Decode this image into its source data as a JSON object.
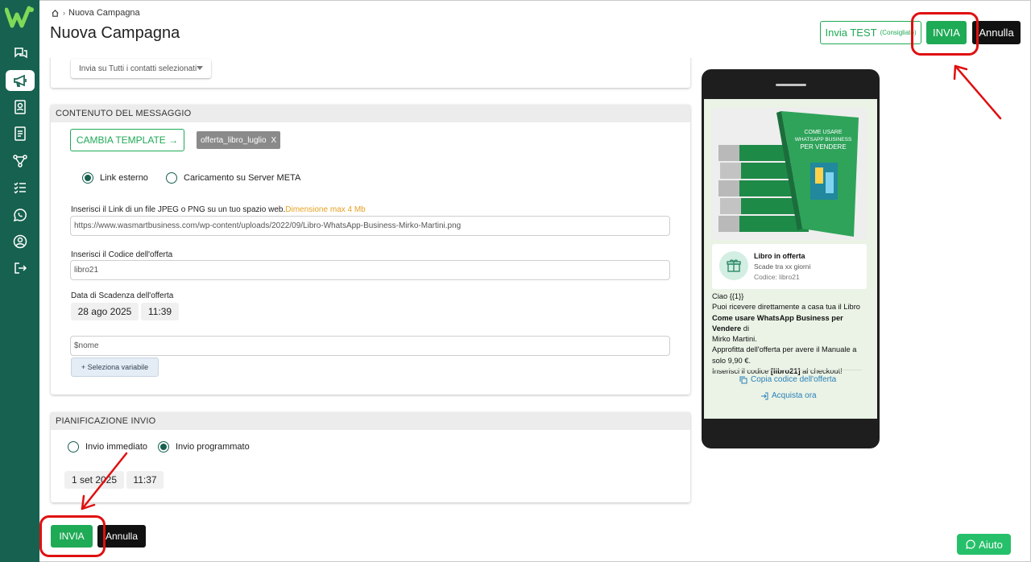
{
  "sidebar": {
    "items": [
      {
        "icon": "chat-icon"
      },
      {
        "icon": "megaphone-icon",
        "active": true
      },
      {
        "icon": "contacts-icon"
      },
      {
        "icon": "document-icon"
      },
      {
        "icon": "flow-icon"
      },
      {
        "icon": "checklist-icon"
      },
      {
        "icon": "whatsapp-icon"
      },
      {
        "icon": "user-icon"
      },
      {
        "icon": "logout-icon"
      }
    ]
  },
  "header": {
    "breadcrumb": "Nuova Campagna",
    "title": "Nuova Campagna",
    "btn_test": "Invia TEST",
    "btn_test_note": "(Consigliato)",
    "btn_invia": "INVIA",
    "btn_annulla": "Annulla"
  },
  "destinatari": {
    "select_value": "Invia su Tutti i contatti selezionati"
  },
  "contenuto": {
    "header": "CONTENUTO DEL MESSAGGIO",
    "btn_template": "CAMBIA TEMPLATE →",
    "template_chip": "offerta_libro_luglio",
    "chip_close": "X",
    "radio_link": "Link esterno",
    "radio_upload": "Caricamento su Server META",
    "link_label": "Inserisci il Link di un file JPEG o PNG su un tuo spazio web.",
    "link_label_warn": "Dimensione max 4 Mb",
    "link_value": "https://www.wasmartbusiness.com/wp-content/uploads/2022/09/Libro-WhatsApp-Business-Mirko-Martini.png",
    "code_label": "Inserisci il Codice dell'offerta",
    "code_value": "libro21",
    "expiry_label": "Data di Scadenza dell'offerta",
    "expiry_date": "28 ago 2025",
    "expiry_time": "11:39",
    "var_value": "$nome",
    "btn_var": "+ Seleziona variabile"
  },
  "pianificazione": {
    "header": "PIANIFICAZIONE INVIO",
    "radio_now": "Invio immediato",
    "radio_scheduled": "Invio programmato",
    "date": "1 set 2025",
    "time": "11:37"
  },
  "footer": {
    "btn_invia": "INVIA",
    "btn_annulla": "Annulla",
    "btn_aiuto": "Aiuto"
  },
  "preview": {
    "offer_title": "Libro in offerta",
    "offer_expiry": "Scade tra xx giorni",
    "offer_code": "Codice: libro21",
    "book_title_1": "COME USARE",
    "book_title_2": "WHATSAPP BUSINESS",
    "book_title_3": "PER VENDERE",
    "msg_line1": "Ciao {{1}}",
    "msg_line2": "Puoi ricevere direttamente a casa tua il Libro",
    "msg_bold1": "Come usare WhatsApp Business per Vendere",
    "msg_line3_tail": " di",
    "msg_line4": "Mirko Martini.",
    "msg_line5": "Approfitta dell'offerta per avere il Manuale a solo 9,90 €.",
    "msg_line6_pre": "Inserisci il codice ",
    "msg_bold2": "[libro21]",
    "msg_line6_post": " al checkout!",
    "link_copy": "Copia codice dell'offerta",
    "link_buy": "Acquista ora"
  },
  "colors": {
    "sidebar": "#16614f",
    "accent_green": "#1faa56",
    "annotation_red": "#e01010"
  }
}
